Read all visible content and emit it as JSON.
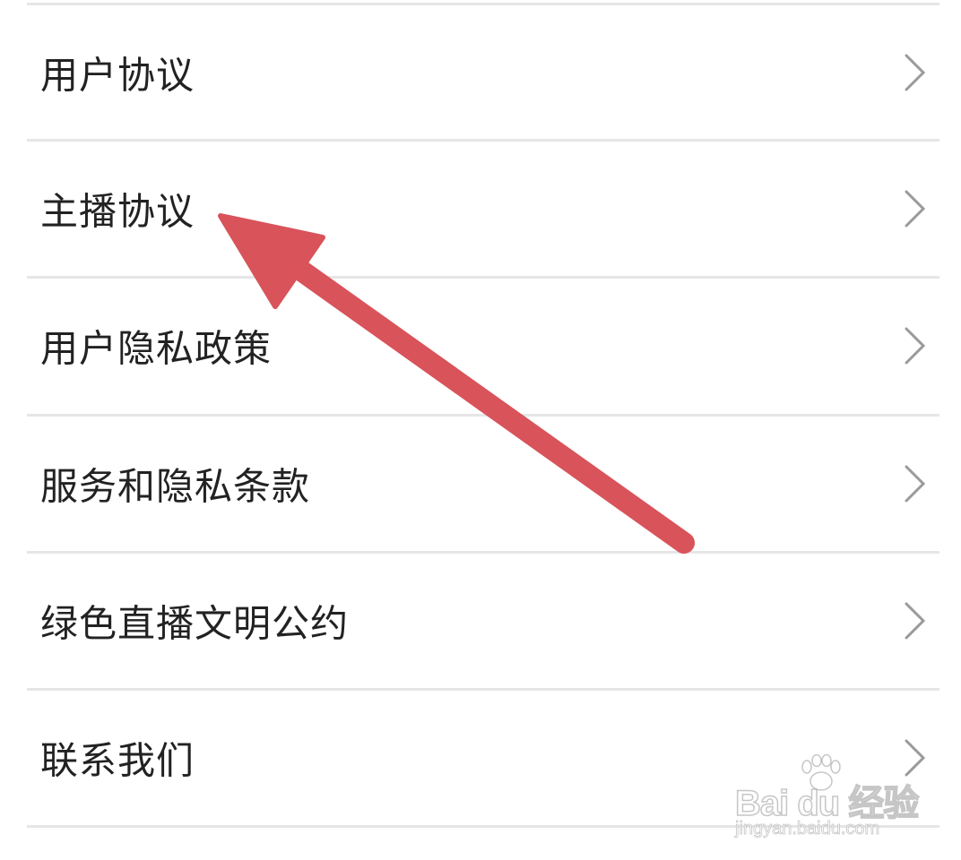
{
  "menu": {
    "items": [
      {
        "label": "用户协议"
      },
      {
        "label": "主播协议"
      },
      {
        "label": "用户隐私政策"
      },
      {
        "label": "服务和隐私条款"
      },
      {
        "label": "绿色直播文明公约"
      },
      {
        "label": "联系我们"
      }
    ]
  },
  "icons": {
    "row_chevron": "chevron-right-icon",
    "annotation": "red-arrow-icon"
  },
  "colors": {
    "background": "#ffffff",
    "divider": "#e6e6e6",
    "label_text": "#222222",
    "chevron": "#9a9a9a",
    "annotation_arrow": "#d9535a"
  },
  "watermark": {
    "logo": "Bai du 经验",
    "url": "jingyan.baidu.com"
  }
}
